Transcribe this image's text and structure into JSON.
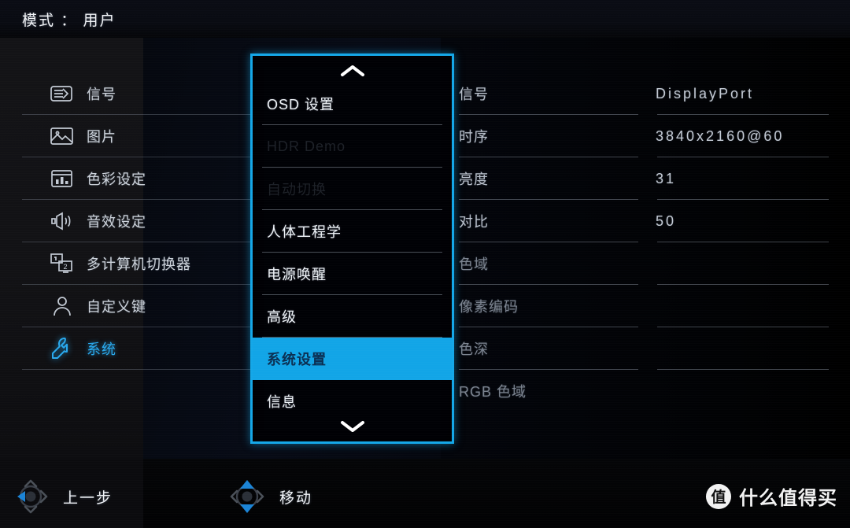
{
  "header": {
    "title": "模式 ： 用户"
  },
  "colors": {
    "accent": "#12a5e7",
    "accent_glow": "#29a9ee",
    "text": "#eef2f6",
    "muted": "#7b838f",
    "disabled": "#1d2128",
    "background": "#010103"
  },
  "sidebar": {
    "items": [
      {
        "label": "信号",
        "icon": "input-signal-icon",
        "active": false
      },
      {
        "label": "图片",
        "icon": "picture-icon",
        "active": false
      },
      {
        "label": "色彩设定",
        "icon": "color-settings-icon",
        "active": false
      },
      {
        "label": "音效设定",
        "icon": "audio-settings-icon",
        "active": false
      },
      {
        "label": "多计算机切换器",
        "icon": "kvm-switch-icon",
        "active": false
      },
      {
        "label": "自定义键",
        "icon": "user-key-icon",
        "active": false
      },
      {
        "label": "系统",
        "icon": "wrench-system-icon",
        "active": true
      }
    ]
  },
  "osd_panel": {
    "scroll_up_icon": "chevron-up-icon",
    "scroll_down_icon": "chevron-down-icon",
    "items": [
      {
        "label": "OSD 设置",
        "state": "normal"
      },
      {
        "label": "HDR Demo",
        "state": "disabled"
      },
      {
        "label": "自动切换",
        "state": "disabled"
      },
      {
        "label": "人体工程学",
        "state": "normal"
      },
      {
        "label": "电源唤醒",
        "state": "normal"
      },
      {
        "label": "高级",
        "state": "normal"
      },
      {
        "label": "系统设置",
        "state": "selected"
      },
      {
        "label": "信息",
        "state": "normal"
      }
    ]
  },
  "info_panel": {
    "rows": [
      {
        "key": "信号",
        "value": "DisplayPort",
        "muted": false
      },
      {
        "key": "时序",
        "value": "3840x2160@60",
        "muted": false
      },
      {
        "key": "亮度",
        "value": "31",
        "muted": false
      },
      {
        "key": "对比",
        "value": "50",
        "muted": false
      },
      {
        "key": "色域",
        "value": "",
        "muted": true
      },
      {
        "key": "像素编码",
        "value": "",
        "muted": true
      },
      {
        "key": "色深",
        "value": "",
        "muted": true
      },
      {
        "key": "RGB 色域",
        "value": "",
        "muted": true
      }
    ]
  },
  "footer": {
    "hints": [
      {
        "label": "上一步",
        "icon": "joystick-left-icon",
        "direction": "left"
      },
      {
        "label": "移动",
        "icon": "joystick-updown-icon",
        "direction": "updown"
      }
    ]
  },
  "watermark": {
    "badge": "值",
    "text": "什么值得买"
  }
}
